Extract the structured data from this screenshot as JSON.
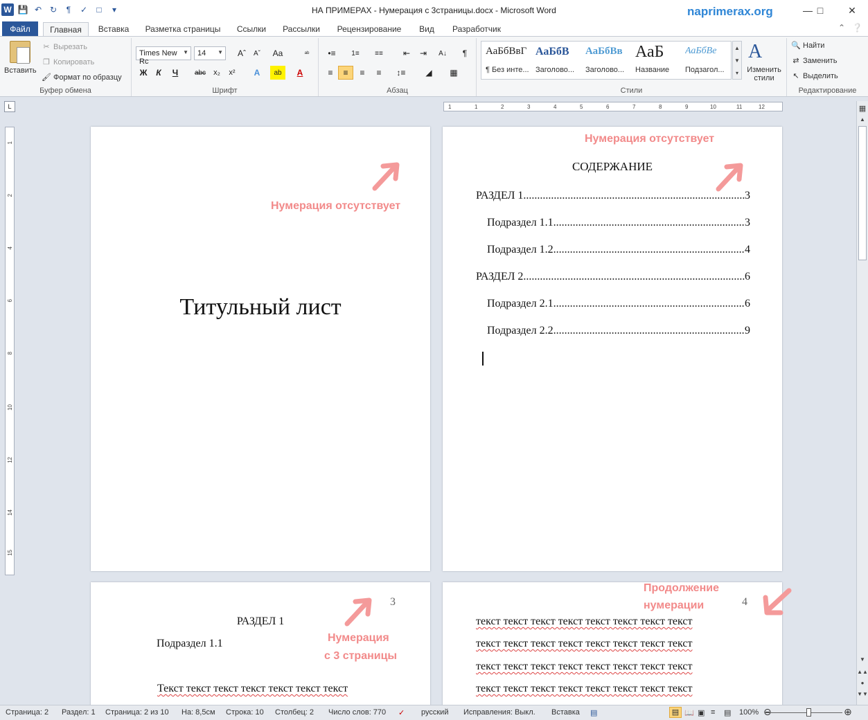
{
  "window": {
    "title": "НА ПРИМЕРАХ - Нумерация с 3страницы.docx - Microsoft Word",
    "brand": "naprimerax.org"
  },
  "tabs": [
    "Файл",
    "Главная",
    "Вставка",
    "Разметка страницы",
    "Ссылки",
    "Рассылки",
    "Рецензирование",
    "Вид",
    "Разработчик"
  ],
  "ribbon": {
    "clipboard": {
      "paste": "Вставить",
      "cut": "Вырезать",
      "copy": "Копировать",
      "format_painter": "Формат по образцу",
      "label": "Буфер обмена"
    },
    "font": {
      "name": "Times New Rc",
      "size": "14",
      "bold": "Ж",
      "italic": "К",
      "underline": "Ч",
      "label": "Шрифт"
    },
    "paragraph": {
      "label": "Абзац"
    },
    "styles": {
      "items": [
        {
          "sample": "АаБбВвГ",
          "name": "¶ Без инте..."
        },
        {
          "sample": "АаБбВ",
          "name": "Заголово..."
        },
        {
          "sample": "АаБбВв",
          "name": "Заголово..."
        },
        {
          "sample": "АаБ",
          "name": "Название"
        },
        {
          "sample": "АаБбВе",
          "name": "Подзагол..."
        }
      ],
      "change": "Изменить стили",
      "label": "Стили"
    },
    "editing": {
      "find": "Найти",
      "replace": "Заменить",
      "select": "Выделить",
      "label": "Редактирование"
    }
  },
  "pages": {
    "page1": {
      "title": "Титульный лист",
      "annotation": "Нумерация отсутствует"
    },
    "page2": {
      "annotation": "Нумерация отсутствует",
      "toc_heading": "СОДЕРЖАНИЕ",
      "toc": [
        {
          "label": "РАЗДЕЛ 1 ",
          "page": "3"
        },
        {
          "label": "Подраздел 1.1",
          "page": "3"
        },
        {
          "label": "Подраздел 1.2",
          "page": "4"
        },
        {
          "label": "РАЗДЕЛ 2 ",
          "page": "6"
        },
        {
          "label": "Подраздел 2.1",
          "page": "6"
        },
        {
          "label": "Подраздел 2.2",
          "page": "9"
        }
      ]
    },
    "page3": {
      "page_number": "3",
      "heading": "РАЗДЕЛ 1",
      "subheading": "Подраздел 1.1",
      "body": "Текст текст текст текст текст текст текст",
      "annotation_line1": "Нумерация",
      "annotation_line2": "с 3 страницы"
    },
    "page4": {
      "page_number": "4",
      "annotation_line1": "Продолжение",
      "annotation_line2": "нумерации",
      "lines": [
        "текст текст текст текст текст текст текст текст",
        "текст текст текст текст текст текст текст текст",
        "текст текст текст текст текст текст текст текст",
        "текст текст текст текст текст текст текст текст"
      ]
    }
  },
  "statusbar": {
    "page": "Страница: 2",
    "section": "Раздел: 1",
    "page_of": "Страница: 2 из 10",
    "at": "На: 8,5см",
    "line": "Строка: 10",
    "column": "Столбец: 2",
    "words": "Число слов: 770",
    "language": "русский",
    "track_changes": "Исправления: Выкл.",
    "insert_mode": "Вставка",
    "zoom": "100%"
  },
  "colors": {
    "accent": "#2b579a",
    "annotation": "#f28a8a",
    "brand": "#2f86d6"
  }
}
